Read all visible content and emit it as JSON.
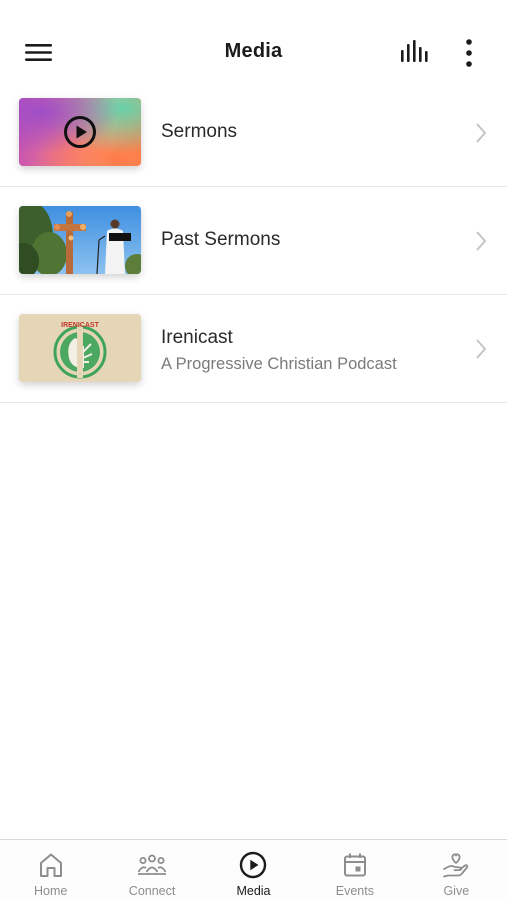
{
  "header": {
    "title": "Media",
    "menu_icon": "hamburger-menu-icon",
    "audio_icon": "audio-bars-icon",
    "more_icon": "vertical-dots-icon"
  },
  "items": [
    {
      "title": "Sermons",
      "subtitle": "",
      "thumbnail": "gradient-play-thumbnail",
      "chevron_icon": "chevron-right-icon"
    },
    {
      "title": "Past Sermons",
      "subtitle": "",
      "thumbnail": "preacher-photo-thumbnail",
      "chevron_icon": "chevron-right-icon"
    },
    {
      "title": "Irenicast",
      "subtitle": "A Progressive Christian Podcast",
      "thumbnail": "irenicast-logo-thumbnail",
      "thumbnail_text": "IRENICAST",
      "chevron_icon": "chevron-right-icon"
    }
  ],
  "tabs": [
    {
      "label": "Home",
      "icon": "home-icon",
      "active": false
    },
    {
      "label": "Connect",
      "icon": "people-group-icon",
      "active": false
    },
    {
      "label": "Media",
      "icon": "play-circle-icon",
      "active": true
    },
    {
      "label": "Events",
      "icon": "calendar-icon",
      "active": false
    },
    {
      "label": "Give",
      "icon": "hand-heart-icon",
      "active": false
    }
  ],
  "colors": {
    "text_primary": "#1b1b1b",
    "text_secondary": "#7a7a7a",
    "tab_inactive": "#8d8d8d",
    "divider": "#e6e6e6",
    "irenicast_green": "#3fa35a",
    "irenicast_red": "#c0392b",
    "irenicast_beige": "#e6d6b8"
  }
}
